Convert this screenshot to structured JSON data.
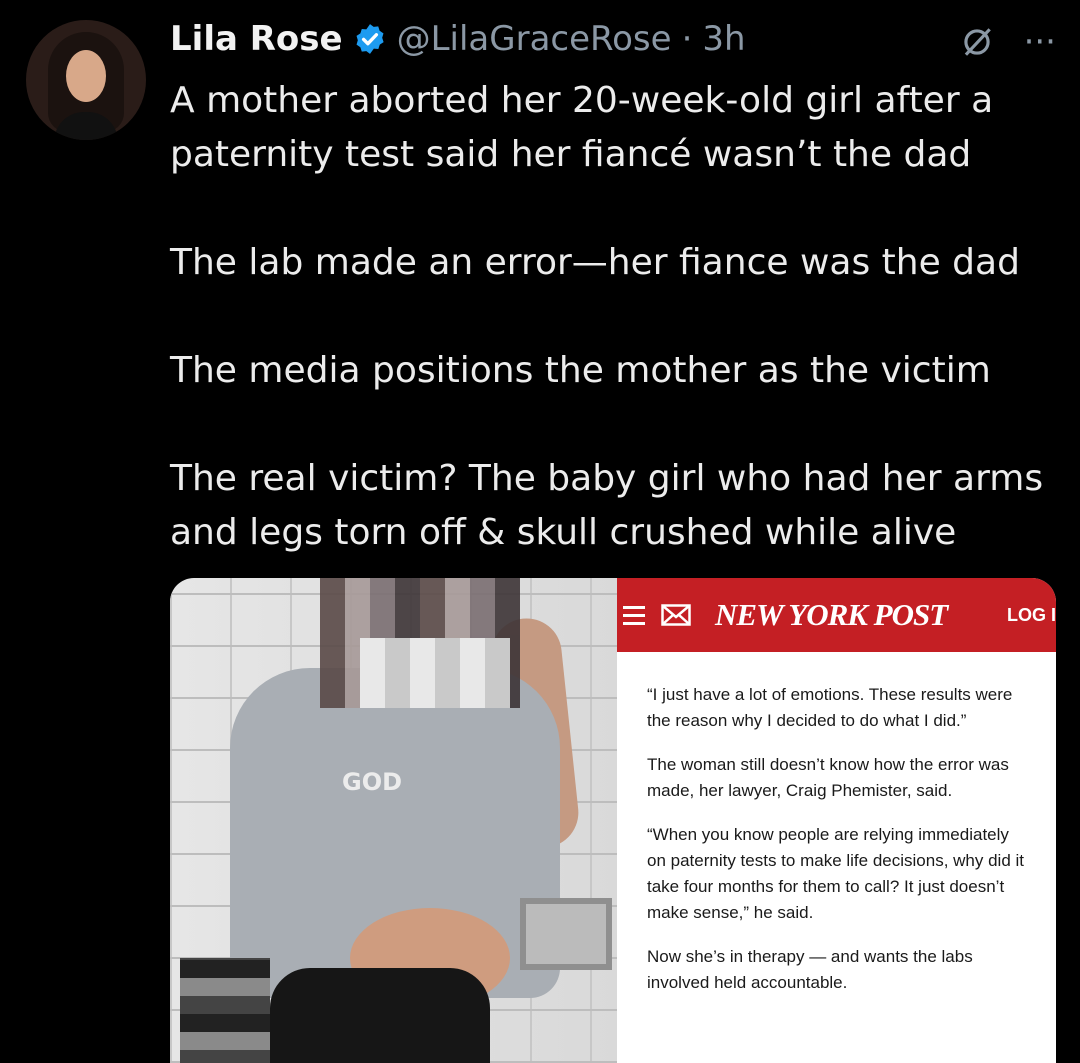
{
  "tweet": {
    "author_name": "Lila Rose",
    "handle": "@LilaGraceRose",
    "separator": "·",
    "time": "3h",
    "more_label": "···",
    "lines": [
      "A mother aborted her 20-week-old girl after a",
      "paternity test said her fiancé wasn’t the dad",
      "The lab made an error—her fiance was the dad",
      "The media positions the mother as the victim",
      "The real victim? The baby girl who had her arms",
      "and legs torn off & skull crushed while alive"
    ]
  },
  "media": {
    "sweater_logo": "GOD",
    "article": {
      "publication": "NEW YORK POST",
      "login_label": "LOG I",
      "paragraphs": [
        "“I just have a lot of emotions. These results were the reason why I decided to do what I did.”",
        "The woman still doesn’t know how the error was made, her lawyer, Craig Phemister, said.",
        "“When you know people are relying immediately on paternity tests to make life decisions, why did it take four months for them to call? It just doesn’t make sense,” he said.",
        "Now she’s in therapy — and wants the labs involved held accountable."
      ]
    }
  },
  "colors": {
    "background": "#000000",
    "text": "#e7e9ea",
    "muted": "#8b98a5",
    "verified": "#1d9bf0",
    "nyp_red": "#c41f24"
  }
}
